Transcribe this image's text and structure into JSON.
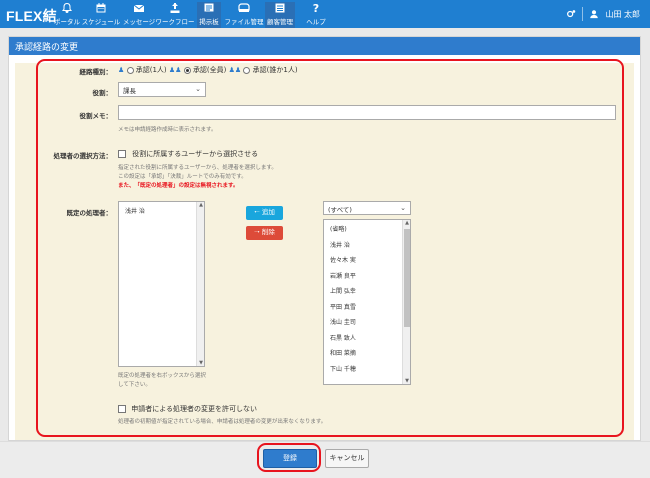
{
  "app": {
    "logo": "FLEX結"
  },
  "nav": [
    {
      "label": "ポータル",
      "icon": "bell-icon"
    },
    {
      "label": "スケジュール",
      "icon": "calendar-icon"
    },
    {
      "label": "メッセージ",
      "icon": "envelope-icon"
    },
    {
      "label": "ワークフロー",
      "icon": "upload-icon"
    },
    {
      "label": "掲示板",
      "icon": "board-icon"
    },
    {
      "label": "ファイル管理",
      "icon": "folder-icon"
    },
    {
      "label": "顧客管理",
      "icon": "customer-icon"
    },
    {
      "label": "ヘルプ",
      "icon": "help-icon"
    }
  ],
  "user": {
    "name": "山田 太郎"
  },
  "panel": {
    "title": "承認経路の変更"
  },
  "form": {
    "route_type_label": "経路種別：",
    "route_options": [
      "承認(1人)",
      "承認(全員)",
      "承認(誰か1人)"
    ],
    "route_selected": 1,
    "role_label": "役割：",
    "role_value": "課長",
    "memo_label": "役割メモ：",
    "memo_value": "",
    "memo_help": "メモは申請経路作成時に表示されます。",
    "method_label": "処理者の選択方法：",
    "method_checkbox": "役割に所属するユーザーから選択させる",
    "method_help1": "指定された役割に所属するユーザーから、処理者を選択します。",
    "method_help2": "この設定は「承認」「決裁」ルートでのみ有効です。",
    "method_warn": "また、「既定の処理者」の設定は無視されます。",
    "default_label": "既定の処理者：",
    "assigned": [
      "浅井 治"
    ],
    "assigned_help1": "既定の処理者を右ボックスから選択",
    "assigned_help2": "して下さい。",
    "add_btn": "追加",
    "delete_btn": "削除",
    "filter_value": "(すべて)",
    "candidates": [
      "(省略)",
      "浅井 治",
      "佐々木 実",
      "岩瀬 良平",
      "上間 弘幸",
      "平田 真雪",
      "浅山 圭司",
      "石黒 致人",
      "和田 菜摘",
      "下山 千穂"
    ],
    "prevent_checkbox": "申請者による処理者の変更を許可しない",
    "prevent_help": "処理者の初期値が指定されている場合、申請者は処理者の変更が出来なくなります。"
  },
  "footer": {
    "submit": "登録",
    "cancel": "キャンセル"
  },
  "colors": {
    "accent": "#1f7fd1",
    "highlight": "#e8141e",
    "form_bg": "#f7f2de"
  }
}
